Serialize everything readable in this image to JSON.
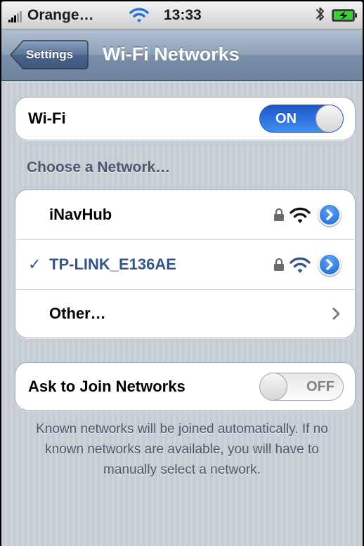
{
  "status_bar": {
    "carrier": "Orange…",
    "time": "13:33",
    "icons": [
      "signal-bars-icon",
      "wifi-icon",
      "bluetooth-icon",
      "battery-charging-icon"
    ]
  },
  "nav": {
    "back_label": "Settings",
    "title": "Wi-Fi Networks"
  },
  "wifi_row": {
    "label": "Wi-Fi",
    "toggle_text": "ON",
    "state": "on"
  },
  "networks_header": "Choose a Network…",
  "networks": [
    {
      "name": "iNavHub",
      "selected": false,
      "secured": true
    },
    {
      "name": "TP-LINK_E136AE",
      "selected": true,
      "secured": true
    }
  ],
  "other_row": {
    "label": "Other…"
  },
  "ask_row": {
    "label": "Ask to Join Networks",
    "toggle_text": "OFF",
    "state": "off"
  },
  "footer_note": "Known networks will be joined automatically. If no known networks are available, you will have to manually select a network.",
  "colors": {
    "accent_blue": "#2e86ec",
    "selected_text": "#34558c",
    "section_text": "#4c566c",
    "background": "#c5ccd4"
  }
}
